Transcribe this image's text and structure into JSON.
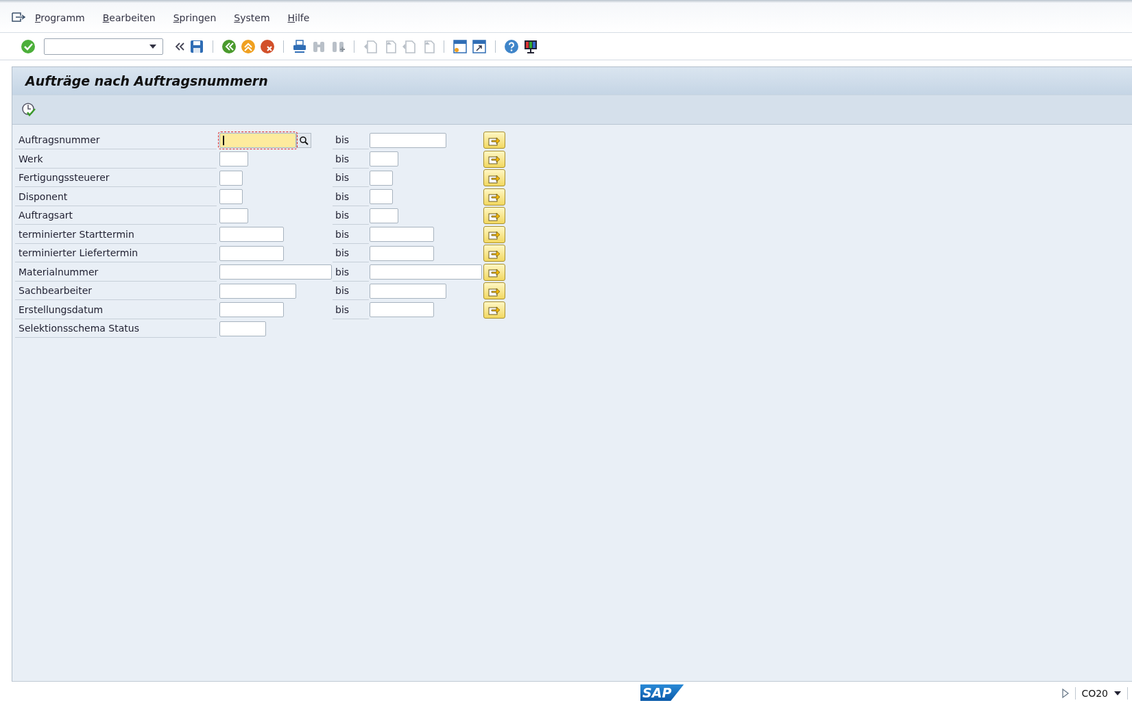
{
  "menu": [
    {
      "label": "Programm"
    },
    {
      "label": "Bearbeiten"
    },
    {
      "label": "Springen"
    },
    {
      "label": "System"
    },
    {
      "label": "Hilfe"
    }
  ],
  "title": "Aufträge nach Auftragsnummern",
  "selection": [
    {
      "label": "Auftragsnummer",
      "kind": "range",
      "focused": true,
      "to_label": "bis"
    },
    {
      "label": "Werk",
      "kind": "range",
      "focused": false,
      "to_label": "bis"
    },
    {
      "label": "Fertigungssteuerer",
      "kind": "range",
      "focused": false,
      "to_label": "bis"
    },
    {
      "label": "Disponent",
      "kind": "range",
      "focused": false,
      "to_label": "bis"
    },
    {
      "label": "Auftragsart",
      "kind": "range",
      "focused": false,
      "to_label": "bis"
    },
    {
      "label": "terminierter Starttermin",
      "kind": "range",
      "focused": false,
      "to_label": "bis"
    },
    {
      "label": "terminierter Liefertermin",
      "kind": "range",
      "focused": false,
      "to_label": "bis"
    },
    {
      "label": "Materialnummer",
      "kind": "range",
      "focused": false,
      "to_label": "bis"
    },
    {
      "label": "Sachbearbeiter",
      "kind": "range",
      "focused": false,
      "to_label": "bis"
    },
    {
      "label": "Erstellungsdatum",
      "kind": "range",
      "focused": false,
      "to_label": "bis"
    },
    {
      "label": "Selektionsschema Status",
      "kind": "single",
      "focused": false
    }
  ],
  "status_bar": {
    "logo": "SAP",
    "transaction": "CO20"
  }
}
